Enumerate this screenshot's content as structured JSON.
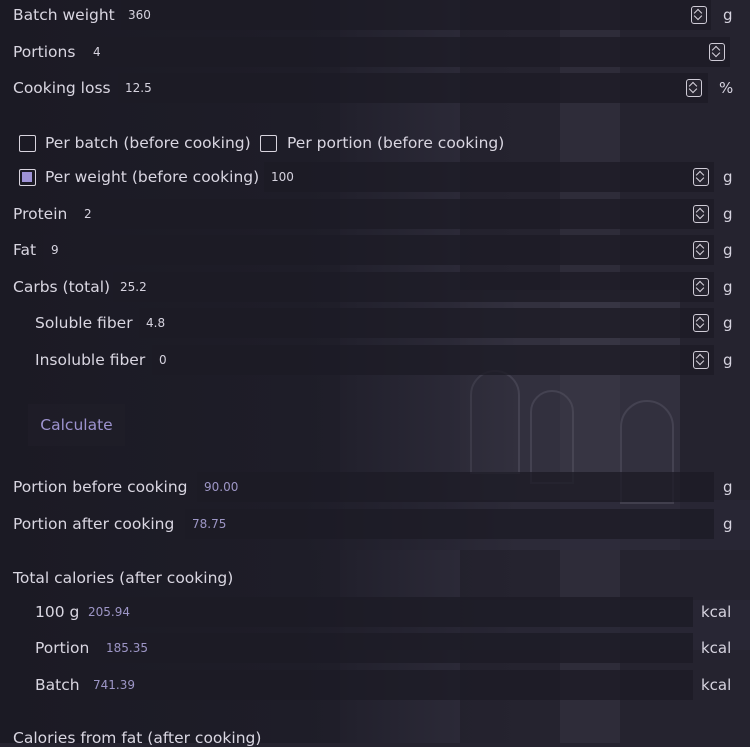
{
  "inputs": {
    "batch_weight": {
      "label": "Batch weight",
      "value": "360",
      "unit": "g"
    },
    "portions": {
      "label": "Portions",
      "value": "4"
    },
    "cooking_loss": {
      "label": "Cooking loss",
      "value": "12.5",
      "unit": "%"
    }
  },
  "mode": {
    "per_batch": {
      "label": "Per batch (before cooking)",
      "checked": false
    },
    "per_portion": {
      "label": "Per portion (before cooking)",
      "checked": false
    },
    "per_weight": {
      "label": "Per weight (before cooking)",
      "checked": true,
      "value": "100",
      "unit": "g"
    }
  },
  "nutrients": {
    "protein": {
      "label": "Protein",
      "value": "2",
      "unit": "g"
    },
    "fat": {
      "label": "Fat",
      "value": "9",
      "unit": "g"
    },
    "carbs": {
      "label": "Carbs (total)",
      "value": "25.2",
      "unit": "g"
    },
    "soluble_fiber": {
      "label": "Soluble fiber",
      "value": "4.8",
      "unit": "g"
    },
    "insoluble_fiber": {
      "label": "Insoluble fiber",
      "value": "0",
      "unit": "g"
    }
  },
  "calculate_label": "Calculate",
  "results": {
    "portion_before": {
      "label": "Portion before cooking",
      "value": "90.00",
      "unit": "g"
    },
    "portion_after": {
      "label": "Portion after cooking",
      "value": "78.75",
      "unit": "g"
    },
    "total_calories_heading": "Total calories (after cooking)",
    "cal_100g": {
      "label": "100 g",
      "value": "205.94",
      "unit": "kcal"
    },
    "cal_portion": {
      "label": "Portion",
      "value": "185.35",
      "unit": "kcal"
    },
    "cal_batch": {
      "label": "Batch",
      "value": "741.39",
      "unit": "kcal"
    },
    "fat_calories_heading": "Calories from fat (after cooking)"
  },
  "colors": {
    "accent": "#9f93d6",
    "field_bg": "#1c1b25",
    "text": "#d9d6e1"
  }
}
